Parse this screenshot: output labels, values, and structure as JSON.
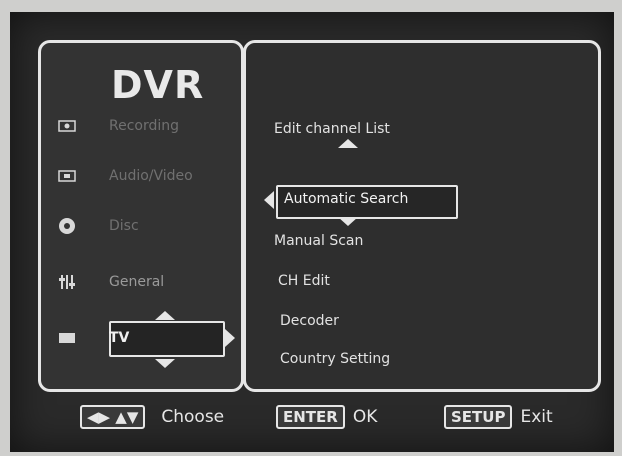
{
  "brand": "DVR",
  "left_menu": [
    {
      "label": "Recording",
      "icon": "record-icon"
    },
    {
      "label": "Audio/Video",
      "icon": "audio-video-icon"
    },
    {
      "label": "Disc",
      "icon": "disc-icon"
    },
    {
      "label": "General",
      "icon": "general-settings-icon"
    },
    {
      "label": "TV",
      "icon": "tv-icon"
    }
  ],
  "tv_submenu": [
    "Edit channel List",
    "Automatic Search",
    "Manual Scan",
    "CH Edit",
    "Decoder",
    "Country Setting"
  ],
  "footer": {
    "choose_keys": "◀▶ ▲▼",
    "choose_label": "Choose",
    "enter_key": "ENTER",
    "ok_label": "OK",
    "setup_key": "SETUP",
    "exit_label": "Exit"
  },
  "colors": {
    "frame": "#e6e6e6",
    "screen_bg": "#2a2a2a",
    "inactive_text": "#707070"
  }
}
